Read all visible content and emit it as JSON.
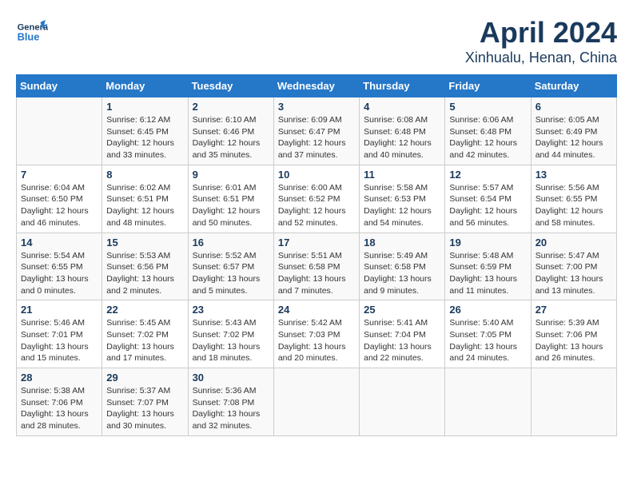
{
  "app": {
    "logo_general": "General",
    "logo_blue": "Blue"
  },
  "title": "April 2024",
  "subtitle": "Xinhualu, Henan, China",
  "columns": [
    "Sunday",
    "Monday",
    "Tuesday",
    "Wednesday",
    "Thursday",
    "Friday",
    "Saturday"
  ],
  "weeks": [
    [
      {
        "day": "",
        "info": ""
      },
      {
        "day": "1",
        "info": "Sunrise: 6:12 AM\nSunset: 6:45 PM\nDaylight: 12 hours\nand 33 minutes."
      },
      {
        "day": "2",
        "info": "Sunrise: 6:10 AM\nSunset: 6:46 PM\nDaylight: 12 hours\nand 35 minutes."
      },
      {
        "day": "3",
        "info": "Sunrise: 6:09 AM\nSunset: 6:47 PM\nDaylight: 12 hours\nand 37 minutes."
      },
      {
        "day": "4",
        "info": "Sunrise: 6:08 AM\nSunset: 6:48 PM\nDaylight: 12 hours\nand 40 minutes."
      },
      {
        "day": "5",
        "info": "Sunrise: 6:06 AM\nSunset: 6:48 PM\nDaylight: 12 hours\nand 42 minutes."
      },
      {
        "day": "6",
        "info": "Sunrise: 6:05 AM\nSunset: 6:49 PM\nDaylight: 12 hours\nand 44 minutes."
      }
    ],
    [
      {
        "day": "7",
        "info": "Sunrise: 6:04 AM\nSunset: 6:50 PM\nDaylight: 12 hours\nand 46 minutes."
      },
      {
        "day": "8",
        "info": "Sunrise: 6:02 AM\nSunset: 6:51 PM\nDaylight: 12 hours\nand 48 minutes."
      },
      {
        "day": "9",
        "info": "Sunrise: 6:01 AM\nSunset: 6:51 PM\nDaylight: 12 hours\nand 50 minutes."
      },
      {
        "day": "10",
        "info": "Sunrise: 6:00 AM\nSunset: 6:52 PM\nDaylight: 12 hours\nand 52 minutes."
      },
      {
        "day": "11",
        "info": "Sunrise: 5:58 AM\nSunset: 6:53 PM\nDaylight: 12 hours\nand 54 minutes."
      },
      {
        "day": "12",
        "info": "Sunrise: 5:57 AM\nSunset: 6:54 PM\nDaylight: 12 hours\nand 56 minutes."
      },
      {
        "day": "13",
        "info": "Sunrise: 5:56 AM\nSunset: 6:55 PM\nDaylight: 12 hours\nand 58 minutes."
      }
    ],
    [
      {
        "day": "14",
        "info": "Sunrise: 5:54 AM\nSunset: 6:55 PM\nDaylight: 13 hours\nand 0 minutes."
      },
      {
        "day": "15",
        "info": "Sunrise: 5:53 AM\nSunset: 6:56 PM\nDaylight: 13 hours\nand 2 minutes."
      },
      {
        "day": "16",
        "info": "Sunrise: 5:52 AM\nSunset: 6:57 PM\nDaylight: 13 hours\nand 5 minutes."
      },
      {
        "day": "17",
        "info": "Sunrise: 5:51 AM\nSunset: 6:58 PM\nDaylight: 13 hours\nand 7 minutes."
      },
      {
        "day": "18",
        "info": "Sunrise: 5:49 AM\nSunset: 6:58 PM\nDaylight: 13 hours\nand 9 minutes."
      },
      {
        "day": "19",
        "info": "Sunrise: 5:48 AM\nSunset: 6:59 PM\nDaylight: 13 hours\nand 11 minutes."
      },
      {
        "day": "20",
        "info": "Sunrise: 5:47 AM\nSunset: 7:00 PM\nDaylight: 13 hours\nand 13 minutes."
      }
    ],
    [
      {
        "day": "21",
        "info": "Sunrise: 5:46 AM\nSunset: 7:01 PM\nDaylight: 13 hours\nand 15 minutes."
      },
      {
        "day": "22",
        "info": "Sunrise: 5:45 AM\nSunset: 7:02 PM\nDaylight: 13 hours\nand 17 minutes."
      },
      {
        "day": "23",
        "info": "Sunrise: 5:43 AM\nSunset: 7:02 PM\nDaylight: 13 hours\nand 18 minutes."
      },
      {
        "day": "24",
        "info": "Sunrise: 5:42 AM\nSunset: 7:03 PM\nDaylight: 13 hours\nand 20 minutes."
      },
      {
        "day": "25",
        "info": "Sunrise: 5:41 AM\nSunset: 7:04 PM\nDaylight: 13 hours\nand 22 minutes."
      },
      {
        "day": "26",
        "info": "Sunrise: 5:40 AM\nSunset: 7:05 PM\nDaylight: 13 hours\nand 24 minutes."
      },
      {
        "day": "27",
        "info": "Sunrise: 5:39 AM\nSunset: 7:06 PM\nDaylight: 13 hours\nand 26 minutes."
      }
    ],
    [
      {
        "day": "28",
        "info": "Sunrise: 5:38 AM\nSunset: 7:06 PM\nDaylight: 13 hours\nand 28 minutes."
      },
      {
        "day": "29",
        "info": "Sunrise: 5:37 AM\nSunset: 7:07 PM\nDaylight: 13 hours\nand 30 minutes."
      },
      {
        "day": "30",
        "info": "Sunrise: 5:36 AM\nSunset: 7:08 PM\nDaylight: 13 hours\nand 32 minutes."
      },
      {
        "day": "",
        "info": ""
      },
      {
        "day": "",
        "info": ""
      },
      {
        "day": "",
        "info": ""
      },
      {
        "day": "",
        "info": ""
      }
    ]
  ]
}
